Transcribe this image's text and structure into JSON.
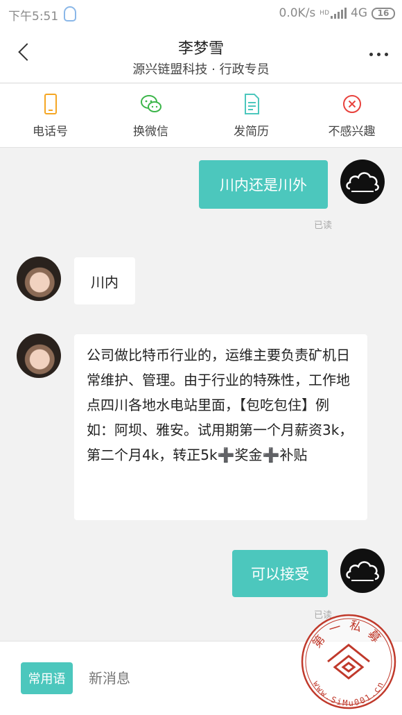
{
  "status_bar": {
    "time": "下午5:51",
    "speed": "0.0K/s",
    "network": "4G",
    "network_sub": "HD",
    "battery": "16",
    "qq_icon": "qq-penguin-icon"
  },
  "header": {
    "title": "李梦雪",
    "subtitle": "源兴链盟科技 · 行政专员",
    "back_icon": "back-arrow-icon",
    "more_icon": "more-icon"
  },
  "actions": [
    {
      "label": "电话号",
      "icon": "phone-icon",
      "color": "#f5a623"
    },
    {
      "label": "换微信",
      "icon": "wechat-icon",
      "color": "#3cb54a"
    },
    {
      "label": "发简历",
      "icon": "resume-icon",
      "color": "#4cc7bd"
    },
    {
      "label": "不感兴趣",
      "icon": "not-interested-icon",
      "color": "#e8413c"
    }
  ],
  "messages": [
    {
      "from": "me",
      "text": "川内还是川外",
      "status": "已读"
    },
    {
      "from": "her",
      "text": "川内"
    },
    {
      "from": "her",
      "text_parts": [
        "公司做比特币行业的，运维主要负责矿机日常维护、管理。由于行业的特殊性，工作地点四川各地水电站里面，【包吃包住】例如：阿坝、雅安。试用期第一个月薪资3k，第二个月4k，转正5k",
        "➕",
        "奖金",
        "➕",
        "补贴"
      ]
    },
    {
      "from": "me",
      "text": "可以接受",
      "status": "已读"
    }
  ],
  "bottom": {
    "phrase_button": "常用语",
    "input_placeholder": "新消息"
  },
  "watermark": {
    "top_text": "第一私募",
    "bottom_text": "www.SiMu001.cn"
  },
  "colors": {
    "accent": "#4cc7bd",
    "plus": "#f36b1c",
    "stamp": "#c0392b"
  }
}
